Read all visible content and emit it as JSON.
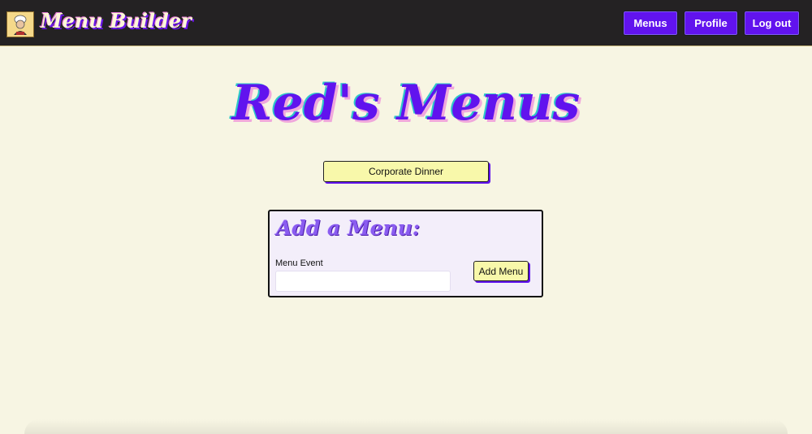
{
  "navbar": {
    "brand": "Menu Builder",
    "logo_icon": "chef-avatar-icon",
    "links": {
      "menus": "Menus",
      "profile": "Profile",
      "logout": "Log out"
    }
  },
  "main": {
    "title": "Red's Menus",
    "menus": [
      {
        "label": "Corporate Dinner"
      }
    ]
  },
  "add_menu": {
    "heading": "Add a Menu:",
    "event_label": "Menu Event",
    "event_value": "",
    "submit_label": "Add Menu"
  },
  "colors": {
    "accent": "#6113ee",
    "navbar_bg": "#242223",
    "page_bg": "#f7f5e3",
    "button_yellow": "#f8f8aa",
    "card_bg": "#f3eefa"
  }
}
